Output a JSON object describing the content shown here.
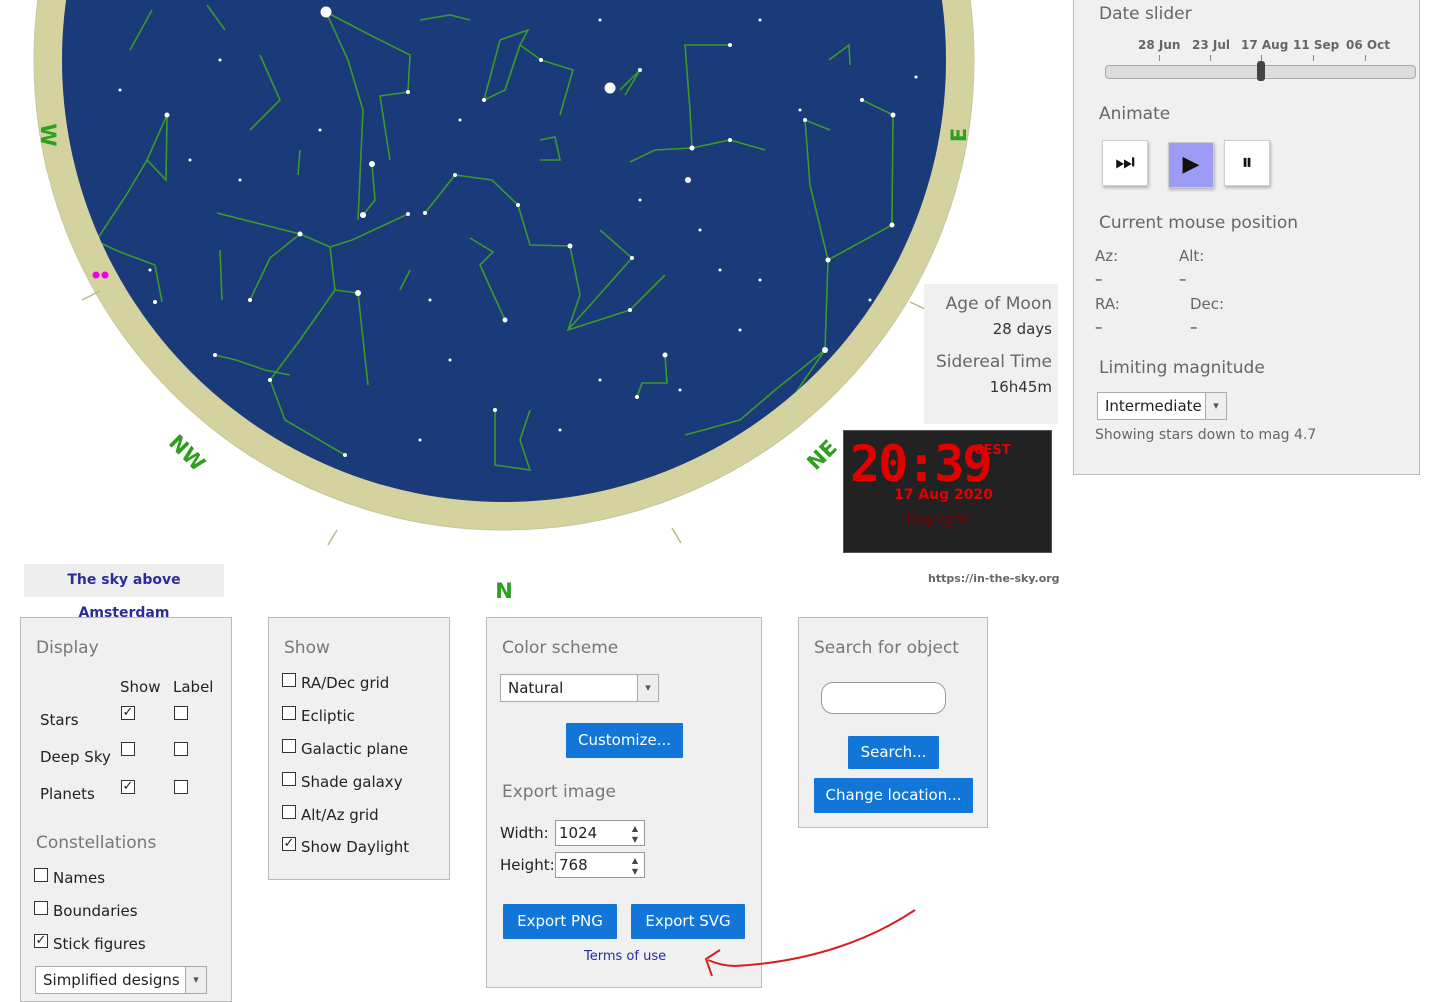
{
  "sky": {
    "title": "The sky above Amsterdam",
    "url": "https://in-the-sky.org",
    "compass": {
      "w": "W",
      "nw": "NW",
      "n": "N",
      "ne": "NE",
      "e": "E"
    }
  },
  "info": {
    "moon_age_label": "Age of Moon",
    "moon_age_value": "28 days",
    "sidereal_label": "Sidereal Time",
    "sidereal_value": "16h45m"
  },
  "clock": {
    "time": "20:39",
    "timezone": "CEST",
    "date": "17 Aug 2020",
    "mode": "Daylight"
  },
  "date_slider": {
    "heading": "Date slider",
    "ticks": [
      "28 Jun",
      "23 Jul",
      "17 Aug",
      "11 Sep",
      "06 Oct"
    ],
    "position_fraction": 0.5
  },
  "animate": {
    "heading": "Animate",
    "buttons": [
      {
        "name": "fast-forward-icon",
        "glyph": "⏭"
      },
      {
        "name": "play-icon",
        "glyph": "▶"
      },
      {
        "name": "pause-icon",
        "glyph": "⏸"
      }
    ]
  },
  "mouse_position": {
    "heading": "Current mouse position",
    "az_label": "Az:",
    "az_value": "–",
    "alt_label": "Alt:",
    "alt_value": "–",
    "ra_label": "RA:",
    "ra_value": "–",
    "dec_label": "Dec:",
    "dec_value": "–"
  },
  "limiting_magnitude": {
    "heading": "Limiting magnitude",
    "selected": "Intermediate",
    "note": "Showing stars down to mag 4.7"
  },
  "display": {
    "heading": "Display",
    "col_show": "Show",
    "col_label": "Label",
    "rows": [
      {
        "label": "Stars",
        "show": true,
        "label_on": false
      },
      {
        "label": "Deep Sky",
        "show": false,
        "label_on": false
      },
      {
        "label": "Planets",
        "show": true,
        "label_on": false
      }
    ],
    "constellations_heading": "Constellations",
    "constellation_options": [
      {
        "label": "Names",
        "checked": false
      },
      {
        "label": "Boundaries",
        "checked": false
      },
      {
        "label": "Stick figures",
        "checked": true
      }
    ],
    "design_selected": "Simplified designs"
  },
  "show": {
    "heading": "Show",
    "options": [
      {
        "label": "RA/Dec grid",
        "checked": false
      },
      {
        "label": "Ecliptic",
        "checked": false
      },
      {
        "label": "Galactic plane",
        "checked": false
      },
      {
        "label": "Shade galaxy",
        "checked": false
      },
      {
        "label": "Alt/Az grid",
        "checked": false
      },
      {
        "label": "Show Daylight",
        "checked": true
      }
    ]
  },
  "color_scheme": {
    "heading": "Color scheme",
    "selected": "Natural",
    "customize_label": "Customize..."
  },
  "export": {
    "heading": "Export image",
    "width_label": "Width:",
    "width_value": "1024",
    "height_label": "Height:",
    "height_value": "768",
    "png_label": "Export PNG",
    "svg_label": "Export SVG",
    "terms_label": "Terms of use"
  },
  "search": {
    "heading": "Search for object",
    "input_value": "",
    "search_label": "Search...",
    "location_label": "Change location..."
  },
  "colors": {
    "sky": "#1b3a7a",
    "horizon_ring": "#d4d3a0",
    "stick_figure": "#3a9a2a",
    "compass_text": "#2f9f1f",
    "button_blue": "#1176d8",
    "clock_red": "#e00000",
    "planet_magenta": "#ee00ee",
    "annotation_arrow": "#d42020"
  }
}
